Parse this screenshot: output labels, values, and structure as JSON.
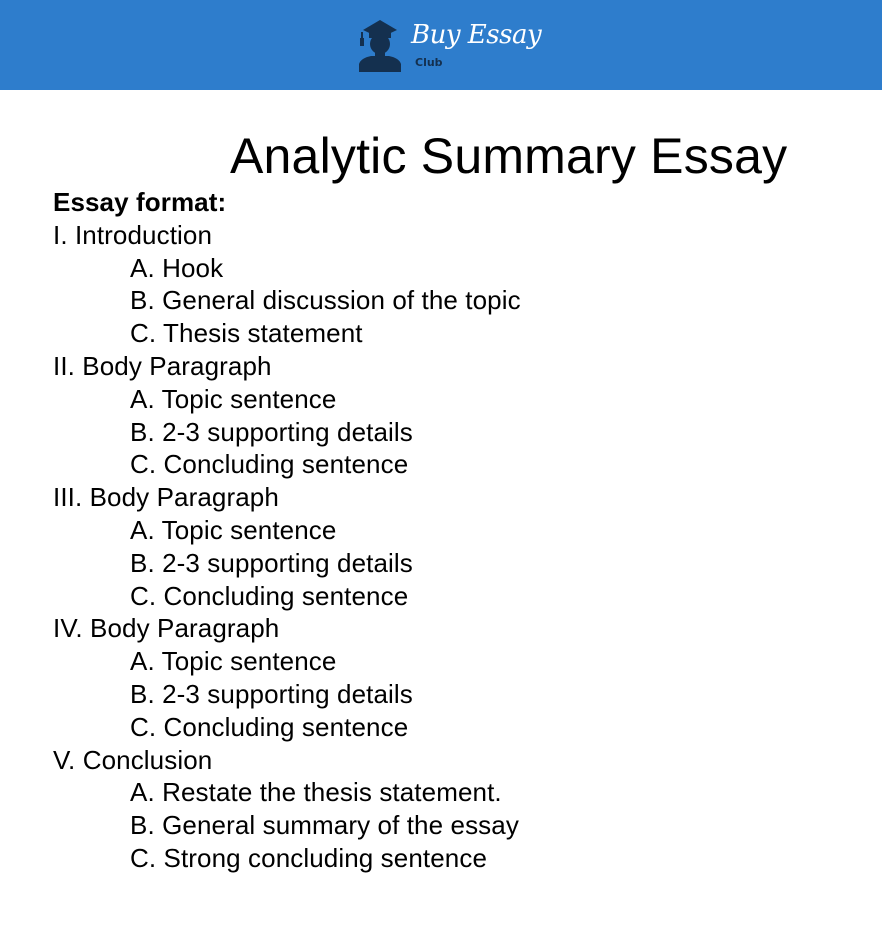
{
  "header": {
    "brand_name": "Buy Essay",
    "brand_sub": "Club",
    "logo_icon": "graduate-silhouette-icon",
    "colors": {
      "bar": "#2e7dcc",
      "icon": "#14304f",
      "brand_name": "#ffffff",
      "brand_sub": "#14304f"
    }
  },
  "document": {
    "title": "Analytic Summary Essay",
    "format_heading": "Essay format:",
    "sections": [
      {
        "label": "I. Introduction",
        "items": [
          "A. Hook",
          "B. General discussion of the topic",
          "C. Thesis statement"
        ]
      },
      {
        "label": "II. Body Paragraph",
        "items": [
          "A. Topic sentence",
          "B. 2-3 supporting details",
          "C. Concluding sentence"
        ]
      },
      {
        "label": "III. Body Paragraph",
        "items": [
          "A. Topic sentence",
          "B. 2-3 supporting details",
          "C. Concluding sentence"
        ]
      },
      {
        "label": "IV. Body Paragraph",
        "items": [
          "A. Topic sentence",
          "B. 2-3 supporting details",
          "C. Concluding sentence"
        ]
      },
      {
        "label": "V. Conclusion",
        "items": [
          "A. Restate the thesis statement.",
          "B. General summary of the essay",
          "C. Strong concluding sentence"
        ]
      }
    ]
  }
}
